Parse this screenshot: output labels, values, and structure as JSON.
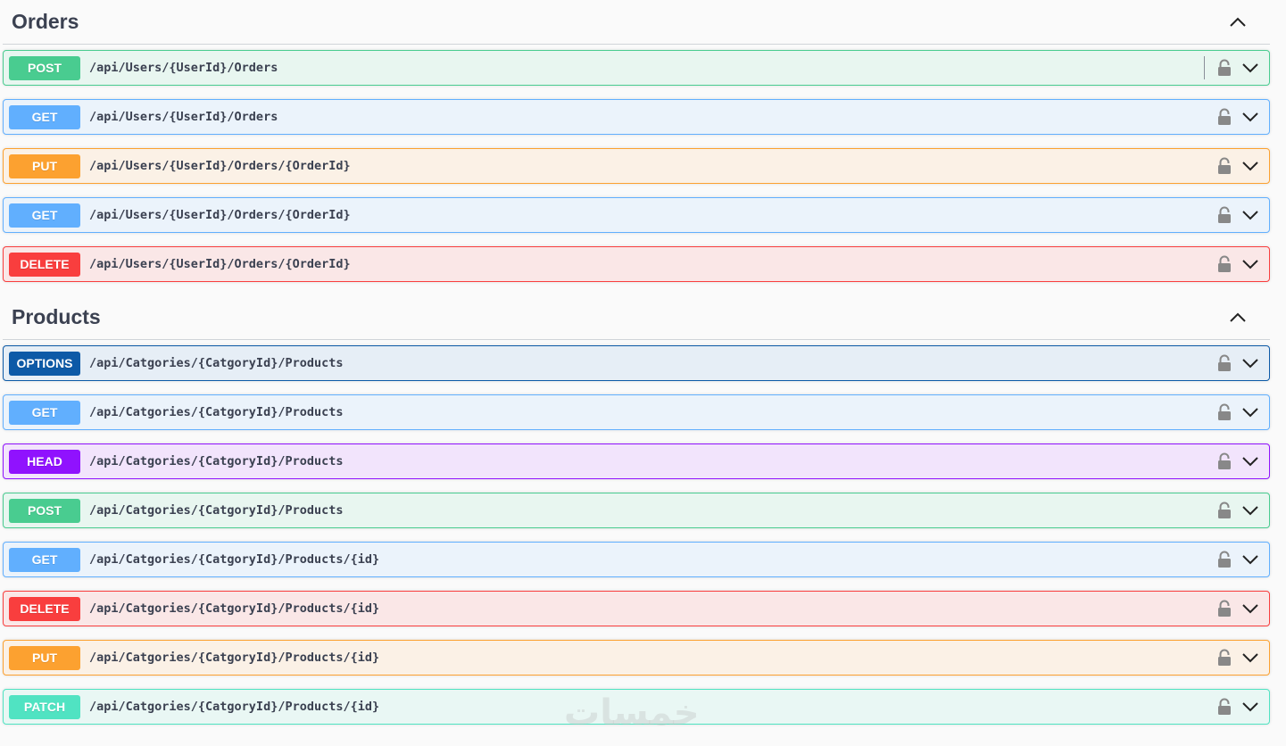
{
  "sections": {
    "orders": {
      "title": "Orders",
      "operations": [
        {
          "method": "POST",
          "path": "/api/Users/{UserId}/Orders"
        },
        {
          "method": "GET",
          "path": "/api/Users/{UserId}/Orders"
        },
        {
          "method": "PUT",
          "path": "/api/Users/{UserId}/Orders/{OrderId}"
        },
        {
          "method": "GET",
          "path": "/api/Users/{UserId}/Orders/{OrderId}"
        },
        {
          "method": "DELETE",
          "path": "/api/Users/{UserId}/Orders/{OrderId}"
        }
      ]
    },
    "products": {
      "title": "Products",
      "operations": [
        {
          "method": "OPTIONS",
          "path": "/api/Catgories/{CatgoryId}/Products"
        },
        {
          "method": "GET",
          "path": "/api/Catgories/{CatgoryId}/Products"
        },
        {
          "method": "HEAD",
          "path": "/api/Catgories/{CatgoryId}/Products"
        },
        {
          "method": "POST",
          "path": "/api/Catgories/{CatgoryId}/Products"
        },
        {
          "method": "GET",
          "path": "/api/Catgories/{CatgoryId}/Products/{id}"
        },
        {
          "method": "DELETE",
          "path": "/api/Catgories/{CatgoryId}/Products/{id}"
        },
        {
          "method": "PUT",
          "path": "/api/Catgories/{CatgoryId}/Products/{id}"
        },
        {
          "method": "PATCH",
          "path": "/api/Catgories/{CatgoryId}/Products/{id}"
        }
      ]
    }
  },
  "icons": {
    "lock": "lock-icon",
    "expand": "chevron-down-icon",
    "collapse": "chevron-up-icon"
  },
  "colors": {
    "post": "#49cc90",
    "get": "#61affe",
    "put": "#fca130",
    "delete": "#f93e3e",
    "options": "#0d5aa7",
    "head": "#9012fe",
    "patch": "#50e3c2"
  },
  "watermark": "خمسات"
}
